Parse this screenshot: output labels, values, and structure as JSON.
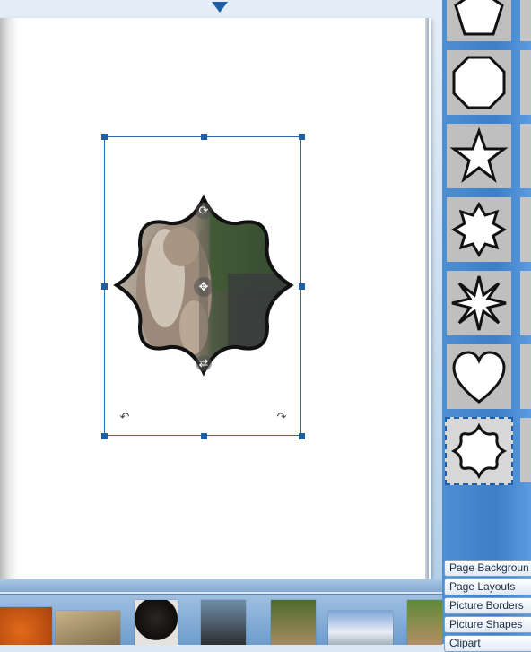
{
  "panel_tabs": [
    {
      "label": "Page Backgroun"
    },
    {
      "label": "Page Layouts"
    },
    {
      "label": "Picture Borders"
    },
    {
      "label": "Picture Shapes"
    },
    {
      "label": "Clipart"
    }
  ],
  "shapes": [
    {
      "name": "pentagon"
    },
    {
      "name": "octagon"
    },
    {
      "name": "star-5"
    },
    {
      "name": "star-8"
    },
    {
      "name": "star-8-sharp"
    },
    {
      "name": "heart"
    },
    {
      "name": "star-8-rounded",
      "selected": true
    }
  ],
  "filmstrip": [
    {
      "name": "basketball"
    },
    {
      "name": "bear-cub"
    },
    {
      "name": "black-bear"
    },
    {
      "name": "chimpanzees"
    },
    {
      "name": "lynx"
    },
    {
      "name": "snowy-mountain"
    },
    {
      "name": "kangaroo"
    }
  ],
  "colors": {
    "accent": "#1f5fa8",
    "panel": "#4a8bd0"
  }
}
